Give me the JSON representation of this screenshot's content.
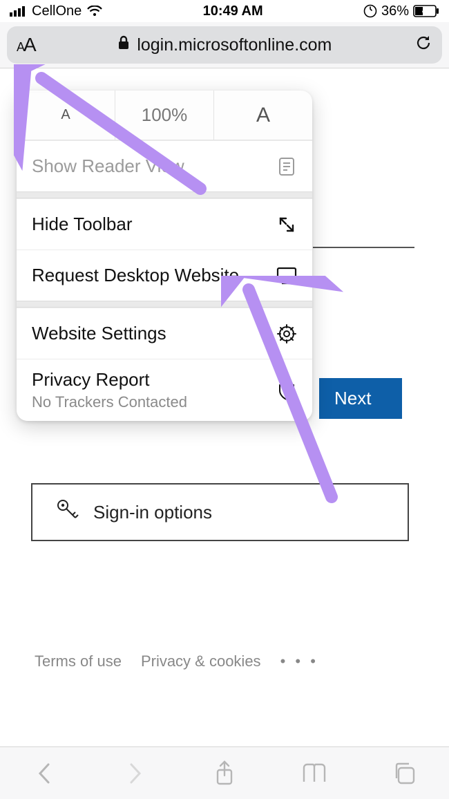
{
  "status": {
    "carrier": "CellOne",
    "time": "10:49 AM",
    "battery_pct": "36%"
  },
  "address_bar": {
    "aa_label": "AA",
    "url": "login.microsoftonline.com"
  },
  "popover": {
    "zoom": "100%",
    "reader_view": "Show Reader View",
    "hide_toolbar": "Hide Toolbar",
    "request_desktop": "Request Desktop Website",
    "website_settings": "Website Settings",
    "privacy_report": "Privacy Report",
    "privacy_sub": "No Trackers Contacted"
  },
  "page": {
    "next": "Next",
    "signin_options": "Sign-in options",
    "terms": "Terms of use",
    "privacy": "Privacy & cookies"
  },
  "annotation": {
    "arrow_color": "#b690f2"
  }
}
